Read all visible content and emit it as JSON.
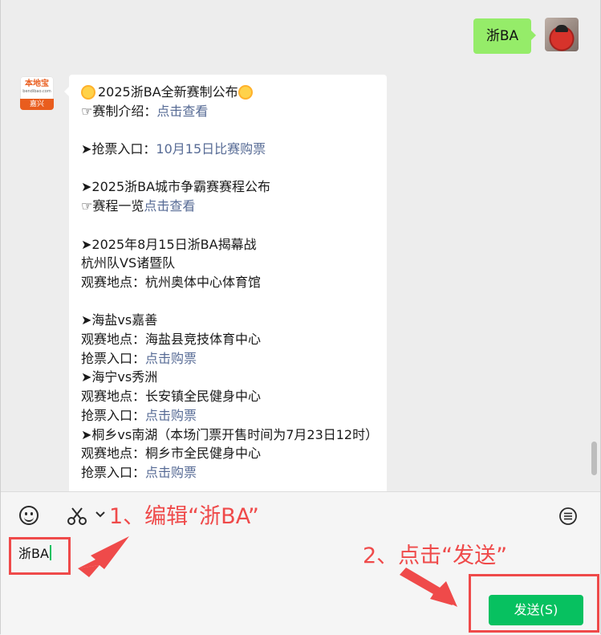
{
  "chat": {
    "outgoing": {
      "text": "浙BA"
    },
    "bot_avatar": {
      "brand": "本地宝",
      "domain": "bendibao.com",
      "city": "嘉兴"
    },
    "incoming": {
      "title": "2025浙BA全新赛制公布",
      "lines": [
        {
          "prefix": "☞赛制介绍：",
          "link": "点击查看"
        },
        {
          "prefix": "",
          "link": ""
        },
        {
          "prefix": "➤抢票入口：",
          "link": "10月15日比赛购票"
        },
        {
          "prefix": "",
          "link": ""
        },
        {
          "prefix": "➤2025浙BA城市争霸赛赛程公布",
          "link": ""
        },
        {
          "prefix": "☞赛程一览",
          "link": "点击查看"
        },
        {
          "prefix": "",
          "link": ""
        },
        {
          "prefix": "➤2025年8月15日浙BA揭幕战",
          "link": ""
        },
        {
          "prefix": "杭州队VS诸暨队",
          "link": ""
        },
        {
          "prefix": "观赛地点：杭州奥体中心体育馆",
          "link": ""
        },
        {
          "prefix": "",
          "link": ""
        },
        {
          "prefix": "➤海盐vs嘉善",
          "link": ""
        },
        {
          "prefix": "观赛地点：海盐县竞技体育中心",
          "link": ""
        },
        {
          "prefix": "抢票入口：",
          "link": "点击购票"
        },
        {
          "prefix": "➤海宁vs秀洲",
          "link": ""
        },
        {
          "prefix": "观赛地点：长安镇全民健身中心",
          "link": ""
        },
        {
          "prefix": "抢票入口：",
          "link": "点击购票"
        },
        {
          "prefix": "➤桐乡vs南湖（本场门票开售时间为7月23日12时）",
          "link": ""
        },
        {
          "prefix": "观赛地点：桐乡市全民健身中心",
          "link": ""
        },
        {
          "prefix": "抢票入口：",
          "link": "点击购票"
        }
      ]
    }
  },
  "composer": {
    "input_value": "浙BA",
    "send_label": "发送(S)",
    "icons": [
      "emoji-icon",
      "scissors-icon",
      "chevron-down-icon",
      "chat-history-icon"
    ]
  },
  "annotations": {
    "step1": "1、编辑“浙BA”",
    "step2": "2、点击“发送”",
    "color": "#ef4a4a"
  },
  "colors": {
    "outgoing_bubble": "#95ec69",
    "link": "#576b95",
    "send_button": "#07c160"
  }
}
